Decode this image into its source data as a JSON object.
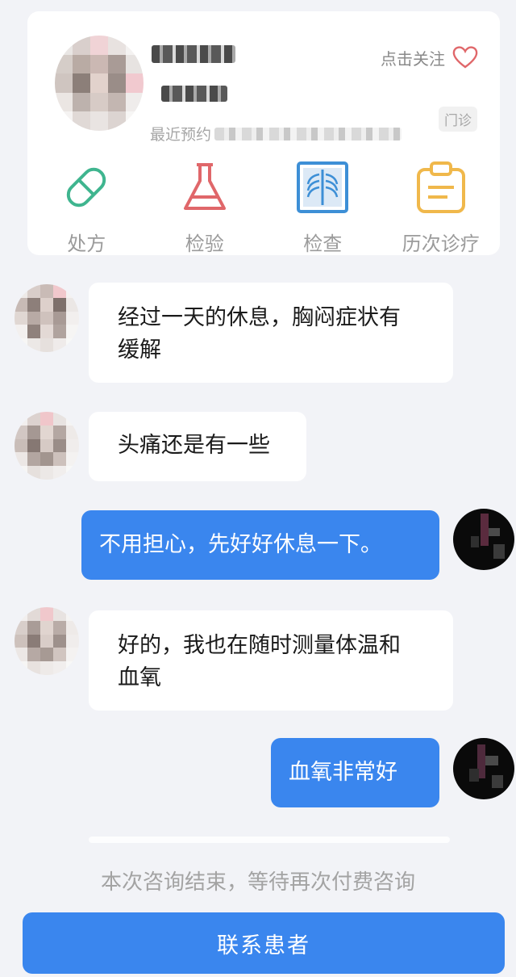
{
  "patient_card": {
    "follow_label": "点击关注",
    "recent_label": "最近预约",
    "clinic_tag": "门诊",
    "tools": [
      {
        "label": "处方",
        "icon": "pill-icon"
      },
      {
        "label": "检验",
        "icon": "flask-icon"
      },
      {
        "label": "检查",
        "icon": "xray-icon"
      },
      {
        "label": "历次诊疗",
        "icon": "clipboard-icon"
      }
    ],
    "colors": {
      "pill": "#3fb58f",
      "flask": "#e0676a",
      "xray": "#3d8fd6",
      "clipboard": "#f0b84b"
    }
  },
  "messages": [
    {
      "from": "patient",
      "text_line1": "经过一天的休息，胸闷症状有",
      "text_line2": "缓解"
    },
    {
      "from": "patient",
      "text": "头痛还是有一些"
    },
    {
      "from": "doctor",
      "text": "不用担心，先好好休息一下。"
    },
    {
      "from": "patient",
      "text_line1": "好的，我也在随时测量体温和",
      "text_line2": "血氧"
    },
    {
      "from": "doctor",
      "text": "血氧非常好"
    }
  ],
  "footer": {
    "end_note": "本次咨询结束，等待再次付费咨询",
    "contact_button": "联系患者"
  },
  "colors": {
    "accent": "#3a86ee",
    "background": "#f2f3f7"
  }
}
